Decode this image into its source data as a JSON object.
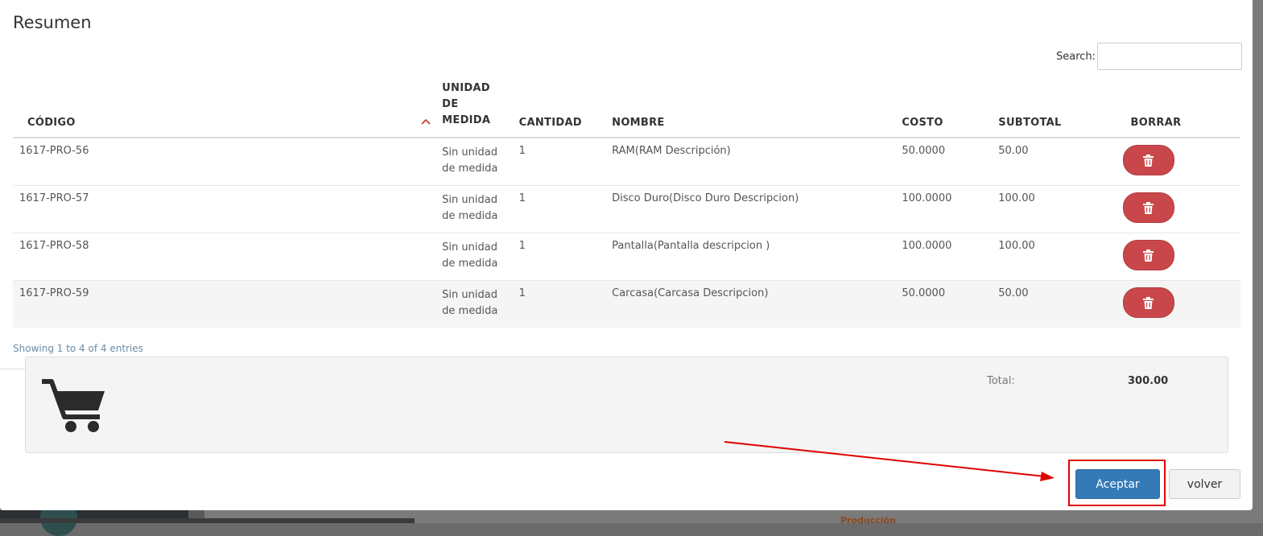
{
  "modal": {
    "title": "Resumen",
    "search": {
      "label": "Search:",
      "value": "",
      "placeholder": ""
    },
    "table": {
      "headers": {
        "codigo": "CÓDIGO",
        "unidad_line1": "UNIDAD",
        "unidad_line2": "DE",
        "unidad_line3": "MEDIDA",
        "cantidad": "CANTIDAD",
        "nombre": "NOMBRE",
        "costo": "COSTO",
        "subtotal": "SUBTOTAL",
        "borrar": "BORRAR"
      },
      "rows": [
        {
          "codigo": "1617-PRO-56",
          "unidad_1": "Sin unidad",
          "unidad_2": "de medida",
          "cantidad": "1",
          "nombre": "RAM(RAM Descripción)",
          "costo": "50.0000",
          "subtotal": "50.00"
        },
        {
          "codigo": "1617-PRO-57",
          "unidad_1": "Sin unidad",
          "unidad_2": "de medida",
          "cantidad": "1",
          "nombre": "Disco Duro(Disco Duro Descripcion)",
          "costo": "100.0000",
          "subtotal": "100.00"
        },
        {
          "codigo": "1617-PRO-58",
          "unidad_1": "Sin unidad",
          "unidad_2": "de medida",
          "cantidad": "1",
          "nombre": "Pantalla(Pantalla descripcion )",
          "costo": "100.0000",
          "subtotal": "100.00"
        },
        {
          "codigo": "1617-PRO-59",
          "unidad_1": "Sin unidad",
          "unidad_2": "de medida",
          "cantidad": "1",
          "nombre": "Carcasa(Carcasa Descripcion)",
          "costo": "50.0000",
          "subtotal": "50.00"
        }
      ]
    },
    "info": "Showing 1 to 4 of 4 entries",
    "summary": {
      "total_label": "Total:",
      "total_value": "300.00",
      "icon": "shopping-cart-icon"
    },
    "buttons": {
      "accept": "Aceptar",
      "back": "volver"
    }
  },
  "background": {
    "partial_text": "Producción"
  },
  "colors": {
    "primary": "#337ab7",
    "danger": "#c9474a",
    "highlight": "#e00000",
    "sort_accent": "#c0392b"
  }
}
